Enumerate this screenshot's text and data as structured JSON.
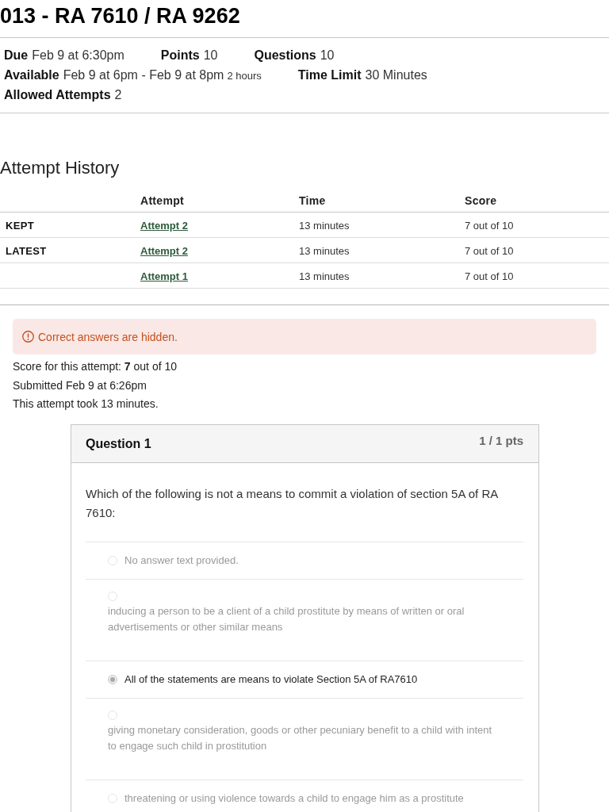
{
  "title": "013 - RA 7610 / RA 9262",
  "details": [
    {
      "items": [
        {
          "label": "Due",
          "value": "Feb 9 at 6:30pm"
        },
        {
          "label": "Points",
          "value": "10"
        },
        {
          "label": "Questions",
          "value": "10"
        }
      ]
    },
    {
      "items": [
        {
          "label": "Available",
          "value": "Feb 9 at 6pm - Feb 9 at 8pm",
          "note": "2 hours"
        },
        {
          "label": "Time Limit",
          "value": "30 Minutes"
        }
      ]
    },
    {
      "items": [
        {
          "label": "Allowed Attempts",
          "value": "2"
        }
      ]
    }
  ],
  "attempt_history": {
    "title": "Attempt History",
    "columns": [
      "Attempt",
      "Time",
      "Score"
    ],
    "rows": [
      {
        "status": "KEPT",
        "attempt": "Attempt 2",
        "time": "13 minutes",
        "score": "7 out of 10"
      },
      {
        "status": "LATEST",
        "attempt": "Attempt 2",
        "time": "13 minutes",
        "score": "7 out of 10"
      },
      {
        "attempt": "Attempt 1",
        "time": "13 minutes",
        "score": "7 out of 10"
      }
    ]
  },
  "alert": {
    "text": "Correct answers are hidden."
  },
  "summary": [
    "Score for this attempt: **7** out of 10",
    "Submitted Feb 9 at 6:26pm",
    "This attempt took 13 minutes."
  ],
  "question": {
    "title": "Question 1",
    "points": "1 / 1 pts",
    "text": "Which of the following is not a means to commit a violation of section 5A of RA 7610:",
    "answers": [
      {
        "kind": "inline",
        "text": "No answer text provided.",
        "selected": false
      },
      {
        "kind": "stacked",
        "text": "inducing a person to be a client of a child prostitute by means of written or oral advertisements or other similar means",
        "selected": false
      },
      {
        "kind": "inline",
        "text": "All of the statements are means to violate Section 5A of RA7610",
        "selected": true
      },
      {
        "kind": "stacked",
        "text": "giving monetary consideration, goods or other pecuniary benefit to a child with intent to engage such child in prostitution",
        "selected": false
      },
      {
        "kind": "inline",
        "text": "threatening or using violence towards a child to engage him as a prostitute",
        "selected": false
      }
    ]
  }
}
